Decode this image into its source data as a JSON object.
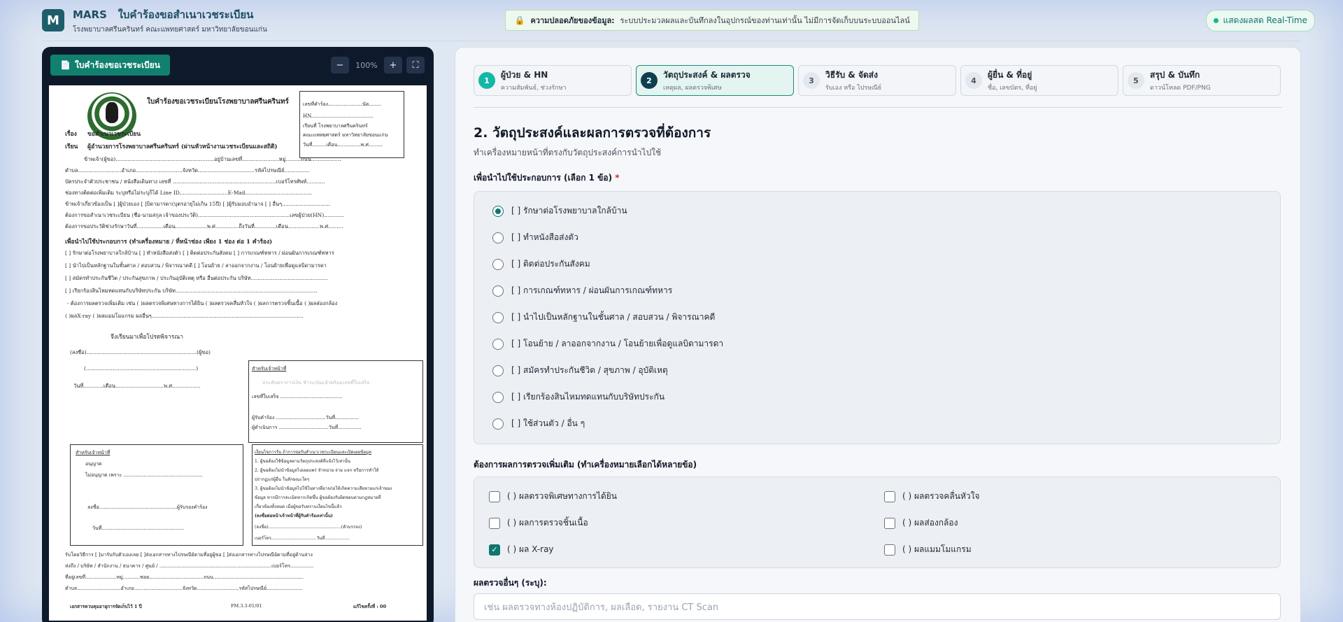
{
  "header": {
    "logo": "M",
    "app": "MARS",
    "title": "ใบคำร้องขอสำเนาเวชระเบียน",
    "subtitle": "โรงพยาบาลศรีนครินทร์ คณะแพทยศาสตร์ มหาวิทยาลัยขอนแก่น",
    "privacy_title": "ความปลอดภัยของข้อมูล:",
    "privacy_text": "ระบบประมวลผลและบันทึกลงในอุปกรณ์ของท่านเท่านั้น ไม่มีการจัดเก็บบนระบบออนไลน์",
    "live_label": "แสดงผลสด Real-Time",
    "lock_icon": "lock-icon"
  },
  "preview": {
    "title": "ใบคำร้องขอเวชระเบียน",
    "zoom": "100%",
    "zoom_out": "−",
    "zoom_in": "+",
    "fullscreen": "⛶",
    "doc": {
      "heading": "ใบคำร้องขอเวชระเบียนโรงพยาบาลศรีนครินทร์",
      "subject_label": "เรื่อง",
      "subject": "ขอสำเนาเวชระเบียน",
      "to_label": "เรียน",
      "to": "ผู้อำนวยการโรงพยาบาลศรีนครินทร์ (ผ่านหัวหน้างานเวชระเบียนและสถิติ)",
      "box_req_no": "เลขที่คำร้อง......................นัด........",
      "box_hn": "HN........................................",
      "box_line3": "เรียนที่ โรงพยาบาลศรีนครินทร์",
      "box_line4": "คณะแพทยศาสตร์ มหาวิทยาลัยขอนแก่น",
      "box_line5": "วันที่.........เดือน...............พ.ศ.........",
      "line1": "ข้าพเจ้า(ผู้ขอ)...........................................................อยู่บ้านเลขที่......................หมู่.........ถนน..................",
      "line2": "ตำบล..........................อำเภอ............................จังหวัด..................................รหัสไปรษณีย์...............",
      "line3": "บัตรประจำตัวประชาชน / หนังสือเดินทาง เลขที่ ..............................................................เบอร์โทรศัพท์...........",
      "line4": "ช่องทางติดต่อเพิ่มเติม ระบุหรือไม่ระบุก็ได้ Line ID.............................E-Mail........................................",
      "line5": "ข้าพเจ้าเกี่ยวข้องเป็น [ ]ผู้ป่วยเอง [ ]บิดามารดา(บุตรอายุไม่เกิน 15ปี) [ ]ผู้รับมอบอำนาจ [ ] อื่นๆ.............................",
      "line6": "ต้องการขอสำเนาเวชระเบียน (ชื่อ-นามสกุล เจ้าของประวัติ).......................................................เลขผู้ป่วย(HN)............",
      "line7": "ต้องการขอประวัติช่วงรักษาวันที่................เดือน...................พ.ศ..............ถึงวันที่.............เดือน...................พ.ศ.........",
      "purpose_head": "เพื่อนำไปใช้ประกอบการ (ทำเครื่องหมาย / ที่หน้าช่อง เพียง 1 ช่อง ต่อ 1 คำร้อง)",
      "p1": "[ ] รักษาต่อโรงพยาบาลใกล้บ้าน [ ] ทำหนังสือส่งตัว [ ] ติดต่อประกันสังคม [ ] การเกณฑ์ทหาร / ผ่อนผันการเกณฑ์ทหาร",
      "p2": "[ ] นำไปเป็นหลักฐานในชั้นศาล / สอบสวน / พิจารณาคดี [ ] โอนย้าย / ลาออกจากงาน / โอนย้ายเพื่อดูแลบิดามารดา",
      "p3": "[ ] สมัครทำประกันชีวิต / ประกันสุขภาพ / ประกันอุบัติเหตุ หรือ อื่นต่อประกัน บริษัท..............................................",
      "p4": "[ ] เรียกร้องสินไหมทดแทนกับบริษัทประกัน บริษัท.....................................................................................",
      "p5": "- ต้องการผลตรวจเพิ่มเติม เช่น ( )ผลตรวจพิเศษทางการได้ยิน ( )ผลตรวจคลื่นหัวใจ ( )ผลการตรวจชิ้นเนื้อ ( )ผลส่องกล้อง",
      "p6": "( )ผลX-ray ( )ผลแมมโมแกรม ผลอื่นๆ...........................................................................................",
      "consider": "จึงเรียนมาเพื่อโปรดพิจารณา",
      "sign1": "(ลงชื่อ)..................................................................(ผู้ขอ)",
      "sign2": "(..................................................................)",
      "sign3": "วันที่............เดือน.............................พ.ศ.................",
      "staff_head": "สำหรับเจ้าหน้าที่",
      "staff_line1": "ประทับตราการเงิน ชำระเงินแล้วพร้อมเลขที่ใบเสร็จ",
      "staff_line2": "เลขที่ใบเสร็จ ........................................",
      "staff_line3": "ผู้รับคำร้อง ................................วันที่...............",
      "staff_line4": "ผู้ดำเนินการ ................................วันที่...............",
      "approve_head": "สำหรับเจ้าหน้าที่",
      "approve1": "อนุญาต",
      "approve2": "ไม่อนุญาต เพราะ ...................................................",
      "approve3": "ลงชื่อ..................................................ผู้รับรองคำร้อง",
      "approve4": "วันที่.....................................................",
      "cond_head": "เงื่อนไขการรับ ถ้าการขอรับสำเนาเวชระเบียนและเปิดเผยข้อมูล",
      "cond1": "1. ผู้ขอต้องใช้ข้อมูลตามวัตถุประสงค์ที่แจ้งไว้เท่านั้น",
      "cond2": "2. ผู้ขอต้องไม่นำข้อมูลไปเผยแพร่ จำหน่าย จ่าย แจก หรือการทำให้",
      "cond3": "ปรากฏแก่ผู้อื่น ในลักษณะใดๆ",
      "cond4": "3. ผู้ขอต้องไม่นำข้อมูลไปใช้ในทางที่อาจก่อให้เกิดความเสียหายแก่เจ้าของ",
      "cond5": "ข้อมูล หากมีการละเมิดหากเกิดขึ้น ผู้ขอต้องรับผิดชอบตามกฎหมายที่",
      "cond6": "เกี่ยวข้องทั้งหมด เมื่อผู้ขอรับทราบเงื่อนไขนี้แล้ว",
      "cond7": "(ลงชื่อต่อหน้าเจ้าหน้าที่ผู้รับคำร้องเท่านั้น)",
      "cond8": "(ลงชื่อ).....................................................(ตัวบรรจง)",
      "cond9": "เบอร์โทร.................................วันที่..................",
      "recv": "รับโดยวิธีการ [ ]มารับกับตัวเองเลย [ ]ส่งเอกสารทางไปรษณีย์ตามที่อยู่ผู้ขอ [ ]ส่งเอกสารทางไปรษณีย์ตามที่อยู่ด้านล่าง",
      "addr1": "ส่งถึง / บริษัท / สำนักงาน / ธนาคาร / ศูนย์ / ........................................................................เบอร์โทร...............",
      "addr2": "ที่อยู่เลขที่....................หมู่...........ซอย...................................ถนน..........................................................",
      "addr3": "ตำบล............................อำเภอ...............................จังหวัด...........................รหัสไปรษณีย์.......................",
      "foot1": "เอกสารควบคุมอายุการจัดเก็บไว้ 1 ปี",
      "foot2": "FM.3.3-01/01",
      "foot3": "แก้ไขครั้งที่ : 00"
    }
  },
  "steps": [
    {
      "num": "1",
      "title": "ผู้ป่วย & HN",
      "sub": "ความสัมพันธ์, ช่วงรักษา"
    },
    {
      "num": "2",
      "title": "วัตถุประสงค์ & ผลตรวจ",
      "sub": "เหตุผล, ผลตรวจพิเศษ"
    },
    {
      "num": "3",
      "title": "วิธีรับ & จัดส่ง",
      "sub": "รับเอง หรือ ไปรษณีย์"
    },
    {
      "num": "4",
      "title": "ผู้ยื่น & ที่อยู่",
      "sub": "ชื่อ, เลขบัตร, ที่อยู่"
    },
    {
      "num": "5",
      "title": "สรุป & บันทึก",
      "sub": "ดาวน์โหลด PDF/PNG"
    }
  ],
  "form": {
    "heading": "2. วัตถุประสงค์และผลการตรวจที่ต้องการ",
    "subheading": "ทำเครื่องหมายหน้าที่ตรงกับวัตถุประสงค์การนำไปใช้",
    "purpose_label": "เพื่อนำไปใช้ประกอบการ (เลือก 1 ข้อ)",
    "required_mark": "*",
    "purposes": [
      "[ ] รักษาต่อโรงพยาบาลใกล้บ้าน",
      "[ ] ทำหนังสือส่งตัว",
      "[ ] ติดต่อประกันสังคม",
      "[ ] การเกณฑ์ทหาร / ผ่อนผันการเกณฑ์ทหาร",
      "[ ] นำไปเป็นหลักฐานในชั้นศาล / สอบสวน / พิจารณาคดี",
      "[ ] โอนย้าย / ลาออกจากงาน / โอนย้ายเพื่อดูแลบิดามารดา",
      "[ ] สมัครทำประกันชีวิต / สุขภาพ / อุบัติเหตุ",
      "[ ] เรียกร้องสินไหมทดแทนกับบริษัทประกัน",
      "[ ] ใช้ส่วนตัว / อื่น ๆ"
    ],
    "selected_purpose": "[ ] รักษาต่อโรงพยาบาลใกล้บ้าน",
    "results_label": "ต้องการผลการตรวจเพิ่มเติม (ทำเครื่องหมายเลือกได้หลายข้อ)",
    "results": [
      {
        "label": "( ) ผลตรวจพิเศษทางการได้ยิน",
        "checked": false
      },
      {
        "label": "( ) ผลตรวจคลื่นหัวใจ",
        "checked": false
      },
      {
        "label": "( ) ผลการตรวจชิ้นเนื้อ",
        "checked": false
      },
      {
        "label": "( ) ผลส่องกล้อง",
        "checked": false
      },
      {
        "label": "( ) ผล X-ray",
        "checked": true
      },
      {
        "label": "( ) ผลแมมโมแกรม",
        "checked": false
      }
    ],
    "other_label": "ผลตรวจอื่นๆ (ระบุ):",
    "other_placeholder": "เช่น ผลตรวจทางห้องปฏิบัติการ, ผลเลือด, รายงาน CT Scan",
    "check_mark": "✓"
  },
  "colors": {
    "accent": "#0f766e",
    "header_brand": "#1d5e6b",
    "preview_bg": "#0e1a2b"
  }
}
